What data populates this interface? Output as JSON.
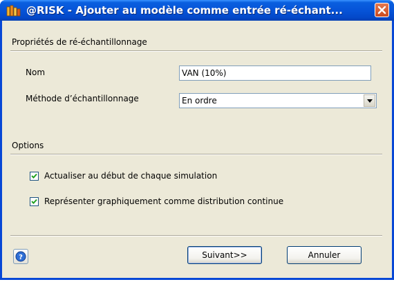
{
  "window": {
    "title": "@RISK - Ajouter au modèle comme entrée ré-échant..."
  },
  "sections": {
    "properties_title": "Propriétés de ré-échantillonnage",
    "options_title": "Options"
  },
  "fields": {
    "name_label": "Nom",
    "name_value": "VAN (10%)",
    "method_label": "Méthode d’échantillonnage",
    "method_value": "En ordre"
  },
  "options": {
    "update_label": "Actualiser au début de chaque simulation",
    "update_checked": true,
    "graph_label": "Représenter graphiquement comme distribution continue",
    "graph_checked": true
  },
  "buttons": {
    "next_label": "Suivant>>",
    "cancel_label": "Annuler"
  },
  "icons": {
    "app": "risk-app-icon",
    "close": "close-icon",
    "help": "help-icon",
    "dropdown": "chevron-down-icon",
    "check": "checkmark-icon"
  }
}
